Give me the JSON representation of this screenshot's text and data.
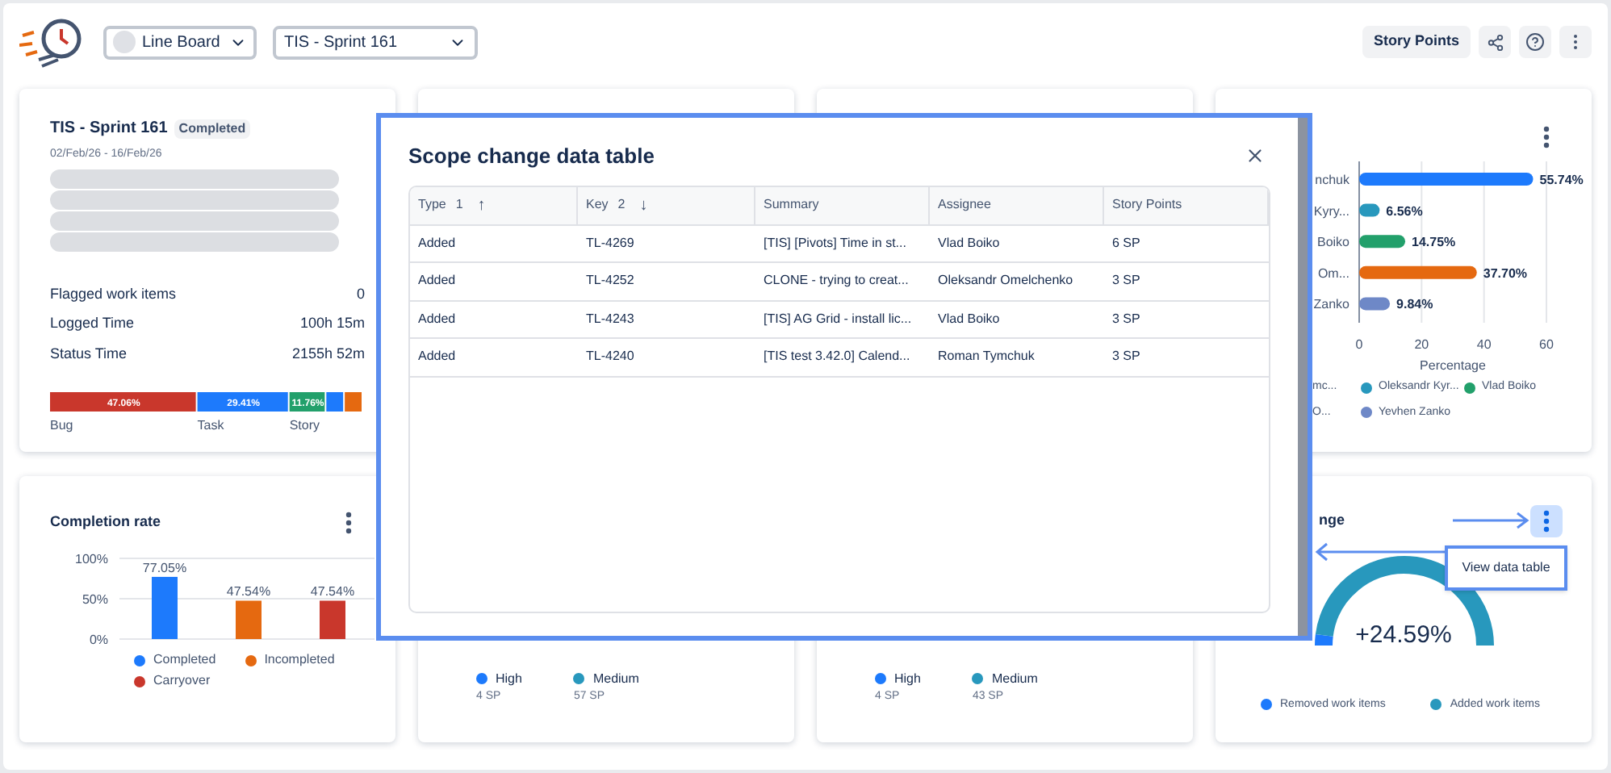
{
  "header": {
    "board_select": {
      "value": "Line Board"
    },
    "sprint_select": {
      "value": "TIS - Sprint 161"
    },
    "story_points_button": "Story Points"
  },
  "sprint_card": {
    "title": "TIS - Sprint 161",
    "status": "Completed",
    "dates": "02/Feb/26 - 16/Feb/26",
    "stats": [
      {
        "label": "Flagged work items",
        "value": "0"
      },
      {
        "label": "Logged Time",
        "value": "100h 15m"
      },
      {
        "label": "Status Time",
        "value": "2155h 52m"
      }
    ],
    "chart_data": {
      "type": "bar",
      "orientation": "horizontal",
      "stacked": true,
      "series": [
        {
          "name": "Bug",
          "color": "#c9372c",
          "values": [
            47.06
          ],
          "value_labels": [
            "47.06%"
          ]
        },
        {
          "name": "Task",
          "color": "#1d7afc",
          "values": [
            29.41
          ],
          "value_labels": [
            "29.41%"
          ]
        },
        {
          "name": "Story",
          "color": "#22a06b",
          "values": [
            11.76
          ],
          "value_labels": [
            "11.76%"
          ]
        },
        {
          "color": "#1d7afc",
          "values": [
            5.88
          ],
          "value_labels": [
            null
          ]
        },
        {
          "color": "#e56910",
          "values": [
            5.89
          ],
          "value_labels": [
            null
          ]
        }
      ]
    }
  },
  "completion_card": {
    "title": "Completion rate",
    "chart_data": {
      "type": "bar",
      "values": [
        77.05,
        47.54,
        47.54
      ],
      "colors": [
        "#1d7afc",
        "#e56910",
        "#c9372c"
      ],
      "ylim": [
        0,
        100
      ],
      "yticks": [
        {
          "value": 0,
          "label": "0%"
        },
        {
          "value": 50,
          "label": "50%"
        },
        {
          "value": 100,
          "label": "100%"
        }
      ],
      "value_labels": [
        "77.05%",
        "47.54%",
        "47.54%"
      ]
    },
    "legend": [
      {
        "label": "Completed",
        "color": "#1d7afc"
      },
      {
        "label": "Incompleted",
        "color": "#e56910"
      },
      {
        "label": "Carryover",
        "color": "#c9372c"
      }
    ]
  },
  "priority_cards": [
    {
      "legend": [
        {
          "label": "High",
          "value": "4 SP",
          "color": "#1d7afc"
        },
        {
          "label": "Medium",
          "value": "57 SP",
          "color": "#2898bd"
        }
      ]
    },
    {
      "legend": [
        {
          "label": "High",
          "value": "4 SP",
          "color": "#1d7afc"
        },
        {
          "label": "Medium",
          "value": "43 SP",
          "color": "#2898bd"
        }
      ]
    }
  ],
  "assignee_card": {
    "chart_data": {
      "type": "bar",
      "orientation": "horizontal",
      "categories": [
        "nchuk",
        "Kyry...",
        "Boiko",
        "Om...",
        "Zanko"
      ],
      "values": [
        55.74,
        6.56,
        14.75,
        37.7,
        9.84
      ],
      "colors": [
        "#1d7afc",
        "#2898bd",
        "#22a06b",
        "#e56910",
        "#6e88c7"
      ],
      "xlabel": "Percentage",
      "xlim": [
        0,
        60
      ],
      "xticks": [
        0,
        20,
        40,
        60
      ],
      "value_labels": [
        "55.74%",
        "6.56%",
        "14.75%",
        "37.70%",
        "9.84%"
      ]
    },
    "legend": [
      {
        "label": "mc..."
      },
      {
        "label": "Oleksandr Kyr...",
        "color": "#2898bd"
      },
      {
        "label": "Vlad Boiko",
        "color": "#22a06b"
      },
      {
        "label": "O..."
      },
      {
        "label": "Yevhen Zanko",
        "color": "#6e88c7"
      }
    ]
  },
  "scope_card": {
    "title": "nge",
    "value": "+24.59%",
    "level": 0.04,
    "tooltip": "View data table",
    "legend": [
      {
        "label": "Removed work items",
        "color": "#1d7afc"
      },
      {
        "label": "Added work items",
        "color": "#2898bd"
      }
    ]
  },
  "modal": {
    "title": "Scope change data table",
    "columns": [
      {
        "label": "Type",
        "sort_order": "1",
        "sort_icon": "↑"
      },
      {
        "label": "Key",
        "sort_order": "2",
        "sort_icon": "↓"
      },
      {
        "label": "Summary"
      },
      {
        "label": "Assignee"
      },
      {
        "label": "Story Points"
      }
    ],
    "rows": [
      [
        "Added",
        "TL-4269",
        "[TIS] [Pivots] Time in st...",
        "Vlad Boiko",
        "6 SP"
      ],
      [
        "Added",
        "TL-4252",
        "CLONE - trying to creat...",
        "Oleksandr Omelchenko",
        "3 SP"
      ],
      [
        "Added",
        "TL-4243",
        "[TIS] AG Grid - install lic...",
        "Vlad Boiko",
        "3 SP"
      ],
      [
        "Added",
        "TL-4240",
        "[TIS test 3.42.0] Calend...",
        "Roman Tymchuk",
        "3 SP"
      ]
    ]
  }
}
